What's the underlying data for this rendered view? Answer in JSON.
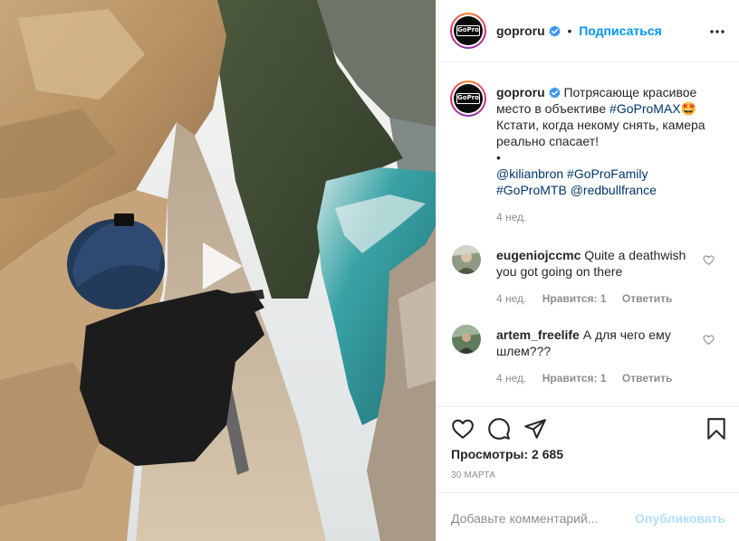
{
  "header": {
    "username": "goproru",
    "follow_label": "Подписаться",
    "separator": "•"
  },
  "caption": {
    "username": "goproru",
    "text_1": "Потрясающе красивое место в объективе",
    "hashtag_1": "#GoProMAX",
    "emoji": "🤩",
    "text_2": "Кстати, когда некому снять, камера реально спасает!",
    "bullet": "•",
    "mention_1": "@kilianbron",
    "hashtag_2": "#GoProFamily",
    "hashtag_3": "#GoProMTB",
    "mention_2": "@redbullfrance",
    "time": "4 нед."
  },
  "comments": [
    {
      "username": "eugeniojccmc",
      "text": "Quite a deathwish you got going on there",
      "time": "4 нед.",
      "likes": "Нравится: 1",
      "reply": "Ответить"
    },
    {
      "username": "artem_freelife",
      "text": "А для чего ему шлем???",
      "time": "4 нед.",
      "likes": "Нравится: 1",
      "reply": "Ответить"
    }
  ],
  "stats": {
    "views": "Просмотры: 2 685",
    "date": "30 МАРТА"
  },
  "add_comment": {
    "placeholder": "Добавьте комментарий...",
    "publish_label": "Опубликовать"
  },
  "brand": {
    "avatar_logo": "GoPro"
  },
  "icons": {
    "header": [
      "verified-icon",
      "more-icon"
    ],
    "actions": [
      "like-icon",
      "comment-icon",
      "share-icon",
      "save-icon"
    ],
    "media": "play-icon"
  },
  "colors": {
    "accent": "#0095f6",
    "verified": "#3897f0",
    "muted": "#8e8e8e",
    "text": "#262626",
    "publish_disabled": "#b2dffc"
  }
}
